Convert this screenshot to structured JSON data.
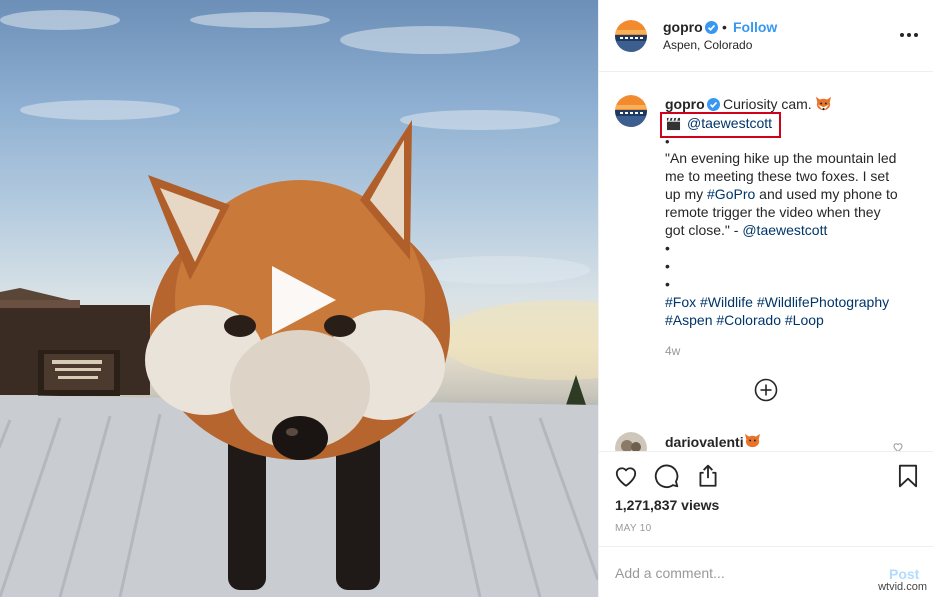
{
  "header": {
    "username": "gopro",
    "separator": "•",
    "follow_label": "Follow",
    "location": "Aspen, Colorado"
  },
  "caption": {
    "username": "gopro",
    "text": "Curiosity cam.",
    "mention": "@taewestcott",
    "bullet": "•",
    "body_lines": [
      "\"An evening hike up the mountain led",
      "me to meeting these two foxes. I set",
      "up my ",
      "remote trigger the video when they",
      "got close.\" - "
    ],
    "gopro_tag": "#GoPro",
    "line3_rest": " and used my phone to",
    "credit": "@taewestcott",
    "hashtags_line1": [
      "#Fox",
      "#Wildlife",
      "#WildlifePhotography"
    ],
    "hashtags_line2": [
      "#Aspen",
      "#Colorado",
      "#Loop"
    ],
    "age": "4w"
  },
  "comment_preview": {
    "username": "dariovalenti"
  },
  "stats": {
    "views": "1,271,837 views",
    "date": "MAY 10"
  },
  "add_comment": {
    "placeholder": "Add a comment...",
    "post_label": "Post"
  },
  "watermark": "wtvid.com",
  "colors": {
    "link": "#003569",
    "follow": "#3897f0",
    "highlight_box": "#d0021b",
    "verified": "#3897f0"
  },
  "icons": [
    "verified-badge-icon",
    "more-options-icon",
    "fox-emoji-icon",
    "clapper-board-icon",
    "plus-circle-icon",
    "heart-icon",
    "comment-icon",
    "share-icon",
    "bookmark-icon",
    "play-icon"
  ]
}
